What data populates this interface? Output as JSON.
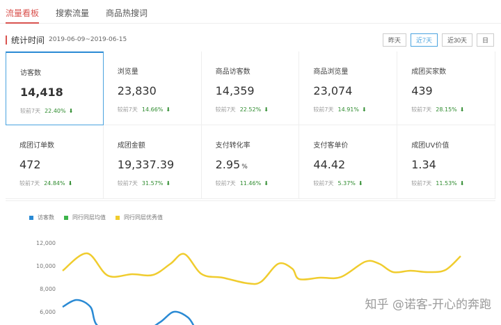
{
  "tabs": [
    "流量看板",
    "搜索流量",
    "商品热搜词"
  ],
  "stat": {
    "label": "统计时间",
    "range": "2019-06-09~2019-06-15"
  },
  "range_buttons": [
    "昨天",
    "近7天",
    "近30天",
    "日"
  ],
  "compare_label": "较前7天",
  "cards": [
    {
      "title": "访客数",
      "value": "14,418",
      "unit": "",
      "pct": "22.40%"
    },
    {
      "title": "浏览量",
      "value": "23,830",
      "unit": "",
      "pct": "14.66%"
    },
    {
      "title": "商品访客数",
      "value": "14,359",
      "unit": "",
      "pct": "22.52%"
    },
    {
      "title": "商品浏览量",
      "value": "23,074",
      "unit": "",
      "pct": "14.91%"
    },
    {
      "title": "成团买家数",
      "value": "439",
      "unit": "",
      "pct": "28.15%"
    },
    {
      "title": "成团订单数",
      "value": "472",
      "unit": "",
      "pct": "24.84%"
    },
    {
      "title": "成团金额",
      "value": "19,337.39",
      "unit": "",
      "pct": "31.57%"
    },
    {
      "title": "支付转化率",
      "value": "2.95",
      "unit": "%",
      "pct": "11.46%"
    },
    {
      "title": "支付客单价",
      "value": "44.42",
      "unit": "",
      "pct": "5.37%"
    },
    {
      "title": "成团UV价值",
      "value": "1.34",
      "unit": "",
      "pct": "11.53%"
    }
  ],
  "chart_data": {
    "type": "line",
    "yticks": [
      12000,
      10000,
      8000,
      6000
    ],
    "legend": [
      {
        "name": "访客数",
        "color": "#2a8ad4"
      },
      {
        "name": "同行同层均值",
        "color": "#3cb44b"
      },
      {
        "name": "同行同层优秀值",
        "color": "#f0cc2e"
      }
    ],
    "series": [
      {
        "name": "同行同层优秀值",
        "color": "#f0cc2e",
        "values": [
          9576,
          11091,
          9152,
          9273,
          9212,
          10182,
          11030,
          9273,
          8970,
          8485,
          8606,
          10182,
          9758,
          8848,
          8970,
          9030,
          10364,
          10182,
          9455,
          9576,
          9455,
          9636,
          10848
        ],
        "x": [
          0,
          35,
          65,
          100,
          130,
          155,
          175,
          200,
          230,
          265,
          285,
          310,
          330,
          340,
          370,
          400,
          435,
          455,
          475,
          500,
          525,
          550,
          572
        ]
      },
      {
        "name": "访客数",
        "color": "#2a8ad4",
        "values": [
          6424,
          7030,
          6424,
          4600,
          4600,
          5091,
          6000,
          5515,
          4600
        ],
        "x": [
          0,
          20,
          40,
          55,
          120,
          140,
          160,
          180,
          190
        ]
      }
    ]
  },
  "watermark": "知乎 @诺客-开心的奔跑"
}
